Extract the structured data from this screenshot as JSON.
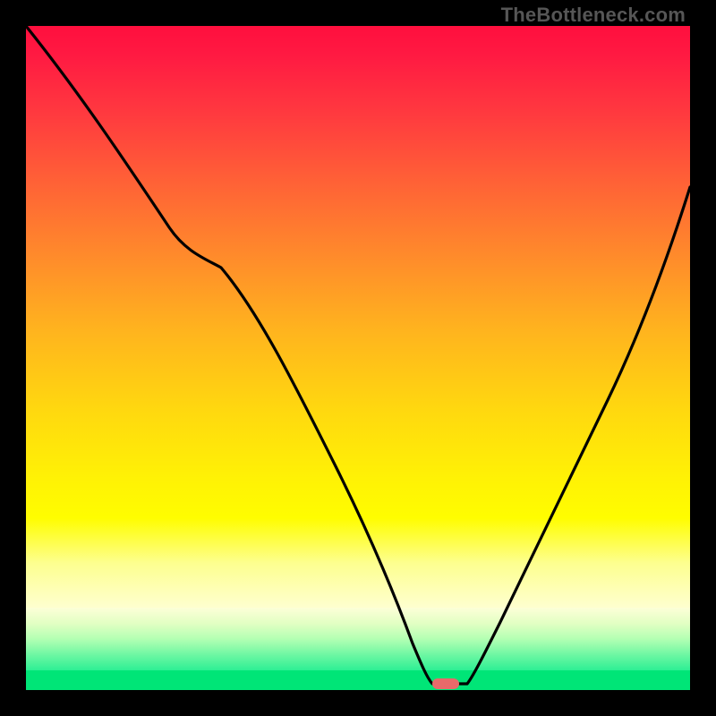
{
  "watermark": "TheBottleneck.com",
  "chart_data": {
    "type": "line",
    "title": "",
    "xlabel": "",
    "ylabel": "",
    "xlim": [
      0,
      100
    ],
    "ylim": [
      0,
      100
    ],
    "grid": false,
    "legend": false,
    "background_layers": [
      {
        "y0": 0,
        "y1": 74,
        "color_top": "#ff1744",
        "color_bottom": "#ffee00",
        "note": "red→yellow gradient"
      },
      {
        "y0": 74,
        "y1": 88,
        "color_top": "#ffee00",
        "color_bottom": "#feffa8",
        "note": "yellow→pale yellow"
      },
      {
        "y0": 88,
        "y1": 97,
        "color_top": "#feffa8",
        "color_bottom": "#3cf59a",
        "note": "pale→green gradient"
      },
      {
        "y0": 97,
        "y1": 100,
        "color_top": "#00e676",
        "color_bottom": "#00e676",
        "note": "solid green strip"
      }
    ],
    "series": [
      {
        "name": "bottleneck-curve",
        "color": "#000000",
        "x": [
          0,
          6,
          12,
          18,
          24,
          29,
          34,
          38,
          44,
          50,
          55,
          58,
          60,
          62,
          64,
          66,
          70,
          74,
          80,
          86,
          92,
          98,
          100
        ],
        "y": [
          0,
          8,
          16,
          24,
          31,
          35,
          43,
          52,
          62,
          73,
          83,
          91,
          96,
          99,
          100,
          100,
          94,
          86,
          73,
          58,
          42,
          24,
          18
        ]
      }
    ],
    "marker": {
      "x": 64,
      "y": 100,
      "color": "#e86a6a",
      "shape": "rounded-rect"
    }
  }
}
